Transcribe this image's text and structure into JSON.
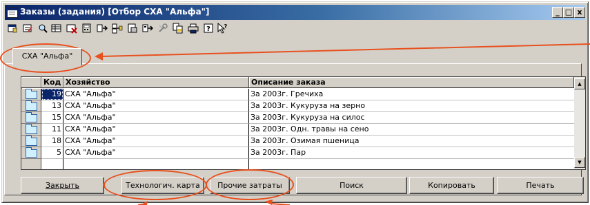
{
  "window": {
    "title": "Заказы (задания) [Отбор СХА \"Альфа\"]",
    "controls": [
      "_",
      "□",
      "x"
    ]
  },
  "toolbar": {
    "icons": [
      "new-icon",
      "edit-icon",
      "find-icon",
      "grid-icon",
      "delete-icon",
      "calc-icon",
      "move-icon",
      "merge-icon",
      "report-icon",
      "export-icon",
      "tools-icon",
      "copy-icon",
      "print-icon",
      "help-icon",
      "pointer-help-icon"
    ]
  },
  "tab": {
    "label": "СХА \"Альфа\""
  },
  "grid": {
    "columns": [
      "Код",
      "Хозяйство",
      "Описание заказа"
    ],
    "rows": [
      {
        "code": "19",
        "farm": "СХА \"Альфа\"",
        "desc": "За 2003г. Гречиха"
      },
      {
        "code": "13",
        "farm": "СХА \"Альфа\"",
        "desc": "За 2003г. Кукуруза на зерно"
      },
      {
        "code": "15",
        "farm": "СХА \"Альфа\"",
        "desc": "За 2003г. Кукуруза на силос"
      },
      {
        "code": "11",
        "farm": "СХА \"Альфа\"",
        "desc": "За 2003г. Одн. травы на сено"
      },
      {
        "code": "18",
        "farm": "СХА \"Альфа\"",
        "desc": "За 2003г. Озимая пшеница"
      },
      {
        "code": "5",
        "farm": "СХА \"Альфа\"",
        "desc": "За 2003г. Пар"
      }
    ]
  },
  "buttons": {
    "close": "Закрыть",
    "tech_card": "Технологич. карта",
    "other_costs": "Прочие затраты",
    "search": "Поиск",
    "copy": "Копировать",
    "print": "Печать"
  },
  "annotation_color": "#e8501e"
}
